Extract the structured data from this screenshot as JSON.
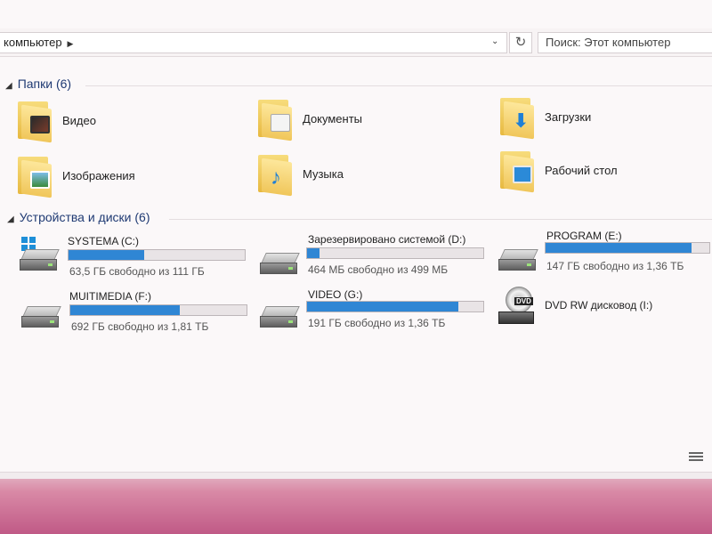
{
  "address": {
    "path": "компьютер",
    "refresh_icon": "refresh-icon"
  },
  "search": {
    "placeholder": "Поиск: Этот компьютер"
  },
  "folders_section": {
    "title": "Папки (6)"
  },
  "folders": [
    {
      "label": "Видео",
      "icon": "video-folder-icon"
    },
    {
      "label": "Документы",
      "icon": "documents-folder-icon"
    },
    {
      "label": "Загрузки",
      "icon": "downloads-folder-icon"
    },
    {
      "label": "Изображения",
      "icon": "pictures-folder-icon"
    },
    {
      "label": "Музыка",
      "icon": "music-folder-icon"
    },
    {
      "label": "Рабочий стол",
      "icon": "desktop-folder-icon"
    }
  ],
  "drives_section": {
    "title": "Устройства и диски (6)"
  },
  "drives": [
    {
      "name": "SYSTEMA (C:)",
      "free": "63,5 ГБ свободно из 111 ГБ",
      "used_fraction": 0.43
    },
    {
      "name": "Зарезервировано системой (D:)",
      "free": "464 МБ свободно из 499 МБ",
      "used_fraction": 0.07
    },
    {
      "name": "PROGRAM (E:)",
      "free": "147 ГБ свободно из 1,36 ТБ",
      "used_fraction": 0.89
    },
    {
      "name": "MUITIMEDIA (F:)",
      "free": "692 ГБ свободно из 1,81 ТБ",
      "used_fraction": 0.62
    },
    {
      "name": "VIDEO (G:)",
      "free": "191 ГБ свободно из 1,36 ТБ",
      "used_fraction": 0.86
    },
    {
      "name": "DVD RW дисковод (I:)",
      "badge": "DVD"
    }
  ],
  "colors": {
    "accent": "#2f86d4",
    "section_title": "#1f3a73"
  }
}
